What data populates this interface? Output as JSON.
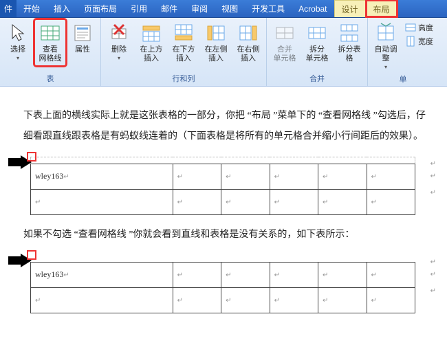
{
  "tabs": {
    "file": "件",
    "home": "开始",
    "insert": "插入",
    "pagelayout": "页面布局",
    "references": "引用",
    "mailings": "邮件",
    "review": "审阅",
    "view": "视图",
    "dev": "开发工具",
    "acrobat": "Acrobat",
    "design": "设计",
    "layout": "布局"
  },
  "ribbon": {
    "table_group": "表",
    "rowscols_group": "行和列",
    "merge_group": "合并",
    "size_group": "单",
    "select": "选择",
    "gridlines": "查看\n网格线",
    "properties": "属性",
    "delete": "删除",
    "insert_above": "在上方插入",
    "insert_below": "在下方插入",
    "insert_left": "在左侧插入",
    "insert_right": "在右侧插入",
    "merge_cells": "合并\n单元格",
    "split_cells": "拆分\n单元格",
    "split_table": "拆分表格",
    "autofit": "自动调整",
    "height": "高度",
    "width": "宽度"
  },
  "content": {
    "para1": "下表上面的横线实际上就是这张表格的一部分，你把 “布局 ”菜单下的 “查看网格线 ”勾选后，仔细看跟直线跟表格是有蚂蚁线连着的（下面表格是将所有的单元格合并缩小行间距后的效果）。",
    "para2": "如果不勾选 “查看网格线 ”你就会看到直线和表格是没有关系的，如下表所示：",
    "cell_text": "wley163",
    "cell_mark": "↵"
  }
}
